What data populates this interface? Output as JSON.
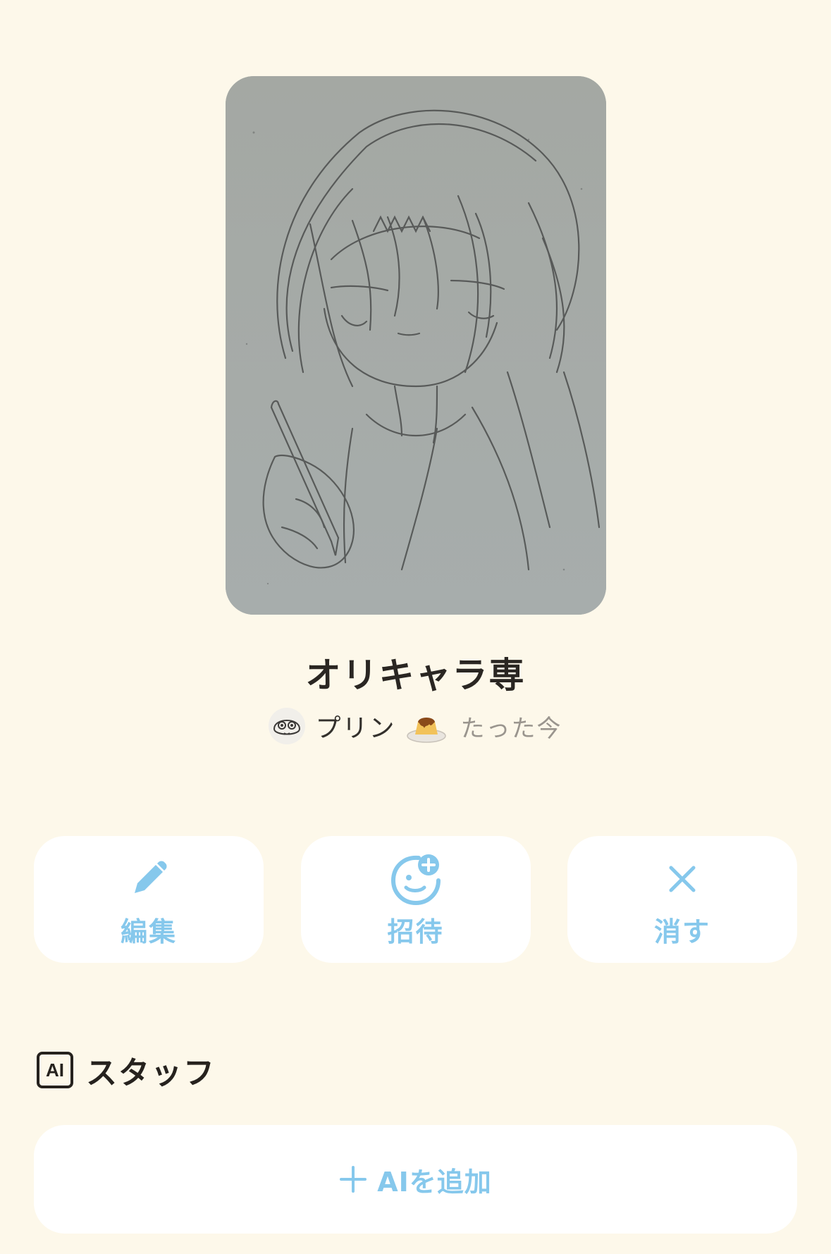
{
  "project": {
    "title": "オリキャラ専",
    "author": "プリン",
    "timestamp": "たった今"
  },
  "actions": [
    {
      "label": "編集",
      "icon": "pencil-icon"
    },
    {
      "label": "招待",
      "icon": "add-person-icon"
    },
    {
      "label": "消す",
      "icon": "close-icon"
    }
  ],
  "staff": {
    "badge": "AI",
    "title": "スタッフ",
    "add_label": "AIを追加"
  },
  "colors": {
    "background": "#fdf8ea",
    "card": "#ffffff",
    "accent": "#86c8ec",
    "text": "#26221e",
    "muted": "#9a958e"
  }
}
